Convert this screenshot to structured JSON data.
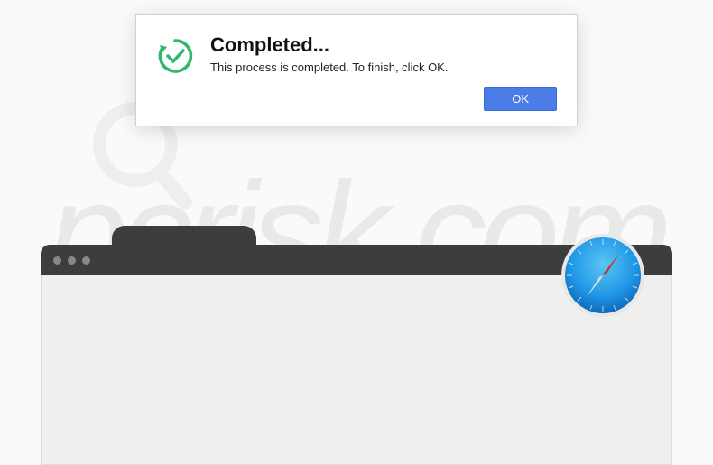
{
  "dialog": {
    "title": "Completed...",
    "message": "This process is completed. To finish, click OK.",
    "ok_label": "OK",
    "icon_name": "checkmark-refresh-icon",
    "icon_color": "#2eb86a"
  },
  "browser": {
    "window_dots": 3,
    "body_color": "#efefef"
  },
  "safari": {
    "icon_name": "safari-compass-icon",
    "accent_color": "#1f97e6"
  },
  "watermark": {
    "text": "pcrisk.com",
    "magnifier": true
  }
}
